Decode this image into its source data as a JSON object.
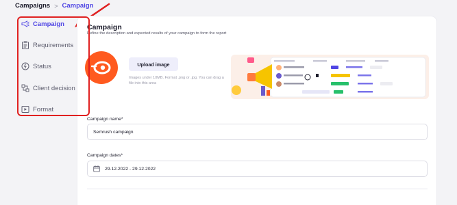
{
  "breadcrumb": {
    "root": "Campaigns",
    "separator": ">",
    "current": "Campaign"
  },
  "sidebar": {
    "items": [
      {
        "label": "Campaign",
        "icon": "megaphone-icon",
        "active": true
      },
      {
        "label": "Requirements",
        "icon": "clipboard-icon",
        "active": false
      },
      {
        "label": "Status",
        "icon": "status-icon",
        "active": false
      },
      {
        "label": "Client decision",
        "icon": "decision-icon",
        "active": false
      },
      {
        "label": "Format",
        "icon": "format-icon",
        "active": false
      }
    ]
  },
  "section": {
    "title": "Campaign",
    "subtitle": "Define the description and expected results of your campaign to form the report"
  },
  "upload": {
    "button_label": "Upload image",
    "hint": "Images under 10MB. Format .png or .jpg. You can drag a file into this area"
  },
  "form": {
    "name_label": "Campaign name*",
    "name_value": "Semrush campaign",
    "dates_label": "Campaign dates*",
    "dates_value": "29.12.2022 - 29.12.2022"
  },
  "colors": {
    "accent": "#4f45e4",
    "highlight": "#e02020",
    "brand": "#ff5a1f"
  }
}
